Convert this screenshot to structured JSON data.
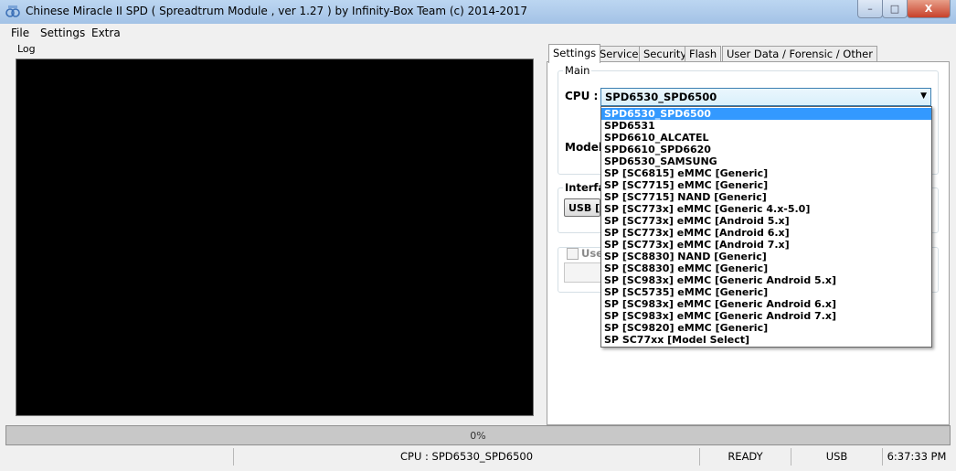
{
  "window": {
    "title": "Chinese Miracle II SPD ( Spreadtrum Module , ver 1.27 ) by Infinity-Box Team (c) 2014-2017",
    "controls": {
      "minimize": "–",
      "maximize": "□",
      "close": "X"
    }
  },
  "menu": [
    "File",
    "Settings",
    "Extra"
  ],
  "log": {
    "label": "Log"
  },
  "tabs": [
    "Settings",
    "Service",
    "Security",
    "Flash",
    "User Data / Forensic / Other"
  ],
  "settings": {
    "main_group": "Main",
    "cpu_label": "CPU :",
    "cpu_selected": "SPD6530_SPD6500",
    "model_label": "Model",
    "interface_group": "Interfa",
    "interface_button": "USB [A",
    "use_checkbox_label": "Use"
  },
  "cpu_options": [
    "SPD6530_SPD6500",
    "SPD6531",
    "SPD6610_ALCATEL",
    "SPD6610_SPD6620",
    "SPD6530_SAMSUNG",
    "SP [SC6815] eMMC [Generic]",
    "SP [SC7715] eMMC [Generic]",
    "SP [SC7715] NAND [Generic]",
    "SP [SC773x] eMMC [Generic 4.x-5.0]",
    "SP [SC773x] eMMC [Android 5.x]",
    "SP [SC773x] eMMC [Android 6.x]",
    "SP [SC773x] eMMC [Android 7.x]",
    "SP [SC8830] NAND [Generic]",
    "SP [SC8830] eMMC [Generic]",
    "SP [SC983x] eMMC [Generic Android 5.x]",
    "SP [SC5735] eMMC [Generic]",
    "SP [SC983x] eMMC [Generic Android 6.x]",
    "SP [SC983x] eMMC [Generic Android 7.x]",
    "SP [SC9820] eMMC [Generic]",
    "SP SC77xx [Model Select]"
  ],
  "progress": {
    "text": "0%",
    "value": 0
  },
  "status": {
    "empty": "",
    "cpu": "CPU : SPD6530_SPD6500",
    "state": "READY",
    "interface": "USB",
    "time": "6:37:33 PM"
  }
}
